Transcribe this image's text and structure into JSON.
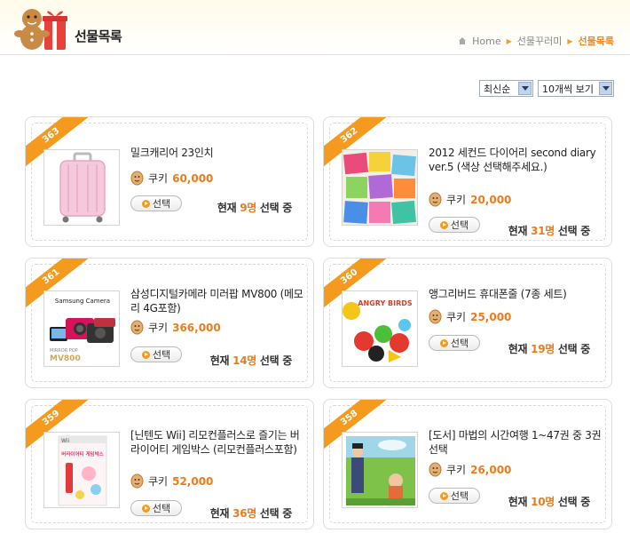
{
  "header": {
    "title": "선물목록",
    "breadcrumb": {
      "home": "Home",
      "parent": "선물꾸러미",
      "current": "선물목록"
    }
  },
  "controls": {
    "sort_selected": "최신순",
    "per_page_selected": "10개씩 보기"
  },
  "common": {
    "cookie_label": "쿠키",
    "select_button": "선택",
    "status_prefix": "현재",
    "status_suffix": "선택 중"
  },
  "products": [
    {
      "no": "363",
      "name": "밀크캐리어 23인치",
      "price": "60,000",
      "selected": "9명",
      "thumb": "suitcase"
    },
    {
      "no": "362",
      "name": "2012 세컨드 다이어리 second diary ver.5 (색상 선택해주세요.)",
      "price": "20,000",
      "selected": "31명",
      "thumb": "diary"
    },
    {
      "no": "361",
      "name": "삼성디지털카메라 미러팝 MV800 (메모리 4G포함)",
      "price": "366,000",
      "selected": "14명",
      "thumb": "camera"
    },
    {
      "no": "360",
      "name": "앵그리버드 휴대폰줄 (7종 세트)",
      "price": "25,000",
      "selected": "19명",
      "thumb": "angrybirds"
    },
    {
      "no": "359",
      "name": "[닌텐도 Wii] 리모컨플러스로 즐기는 버라이어티 게임박스 (리모컨플러스포함)",
      "price": "52,000",
      "selected": "36명",
      "thumb": "wiibox"
    },
    {
      "no": "358",
      "name": "[도서] 마법의 시간여행 1~47권 중 3권 선택",
      "price": "26,000",
      "selected": "10명",
      "thumb": "book"
    }
  ],
  "thumb_text": {
    "camera_brand": "Samsung Camera",
    "camera_model": "MV800",
    "camera_small": "MIRROR POP",
    "angry_title": "ANGRY BIRDS",
    "wii_brand": "Wii",
    "wii_title": "버라이어티 게임박스"
  },
  "colors": {
    "accent": "#ee7b1b",
    "ribbon": "#f39a1f"
  }
}
